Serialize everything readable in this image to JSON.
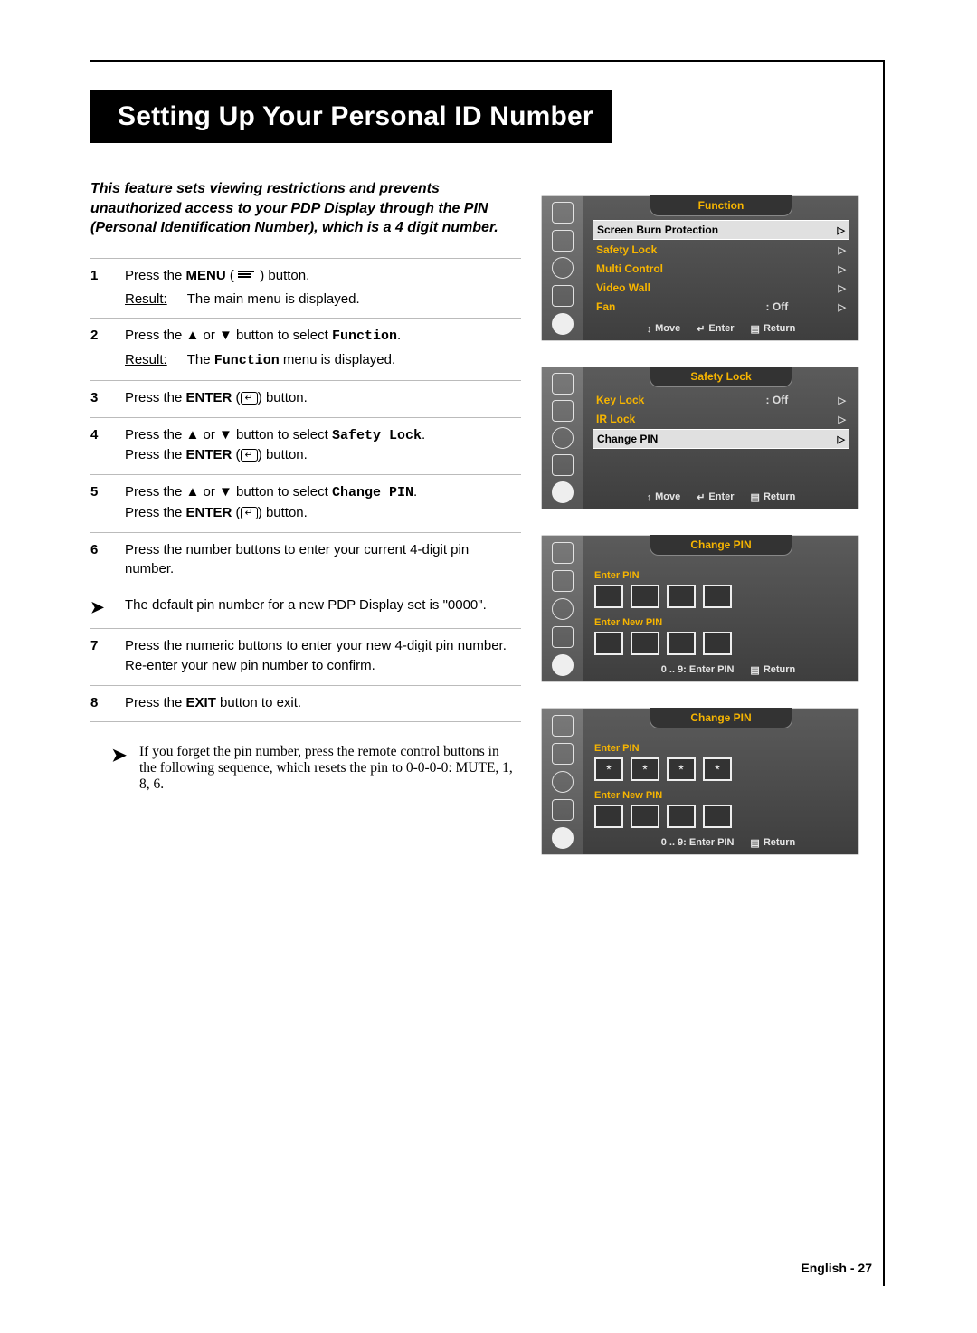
{
  "title": "Setting Up Your Personal ID Number",
  "intro": "This feature sets viewing restrictions and prevents unauthorized access to your PDP Display through the PIN (Personal Identification Number), which is a 4 digit number.",
  "step1": {
    "num": "1",
    "text_a": "Press the ",
    "menu": "MENU",
    "text_b": " button.",
    "result": "Result:",
    "result_text": "The main menu is displayed."
  },
  "step2": {
    "num": "2",
    "text_a": "Press the ▲ or ▼ button to select ",
    "mono": "Function",
    "text_b": ".",
    "result": "Result:",
    "result_text_a": "The ",
    "result_mono": "Function",
    "result_text_b": " menu is displayed."
  },
  "step3": {
    "num": "3",
    "text_a": "Press the ",
    "enter": "ENTER",
    "text_b": " button."
  },
  "step4": {
    "num": "4",
    "line1_a": "Press the ▲ or ▼ button to select ",
    "mono": "Safety Lock",
    "line1_b": ".",
    "line2_a": "Press the ",
    "enter": "ENTER",
    "line2_b": " button."
  },
  "step5": {
    "num": "5",
    "line1_a": "Press the ▲ or ▼ button to select ",
    "mono": "Change PIN",
    "line1_b": ".",
    "line2_a": "Press the ",
    "enter": "ENTER",
    "line2_b": " button."
  },
  "step6": {
    "num": "6",
    "text": "Press the number buttons to enter your current 4-digit pin number."
  },
  "step6_note": {
    "text_a": "The default pin number for a new PDP Display set is \"",
    "b": "0000",
    "text_b": "\"."
  },
  "step7": {
    "num": "7",
    "line1": "Press the numeric buttons to enter your new 4-digit pin number.",
    "line2": "Re-enter your new pin number to confirm."
  },
  "step8": {
    "num": "8",
    "text_a": "Press the ",
    "b": "EXIT",
    "text_b": " button to exit."
  },
  "tail": "If you forget the pin number, press the remote control buttons in the following sequence, which resets the pin to 0-0-0-0: MUTE, 1, 8, 6.",
  "osd": {
    "foot": {
      "move": "Move",
      "enter": "Enter",
      "return": "Return",
      "numeric": "0 .. 9: Enter PIN"
    },
    "p1": {
      "title": "Function",
      "items": [
        {
          "label": "Screen Burn Protection",
          "val": "",
          "selected": true
        },
        {
          "label": "Safety Lock",
          "val": ""
        },
        {
          "label": "Multi Control",
          "val": ""
        },
        {
          "label": "Video Wall",
          "val": ""
        },
        {
          "label": "Fan",
          "val": ": Off"
        }
      ]
    },
    "p2": {
      "title": "Safety Lock",
      "items": [
        {
          "label": "Key Lock",
          "val": ": Off"
        },
        {
          "label": "IR Lock",
          "val": ""
        },
        {
          "label": "Change PIN",
          "val": "",
          "selected": true
        }
      ]
    },
    "p3": {
      "title": "Change PIN",
      "enter_pin": "Enter PIN",
      "enter_new_pin": "Enter New PIN",
      "cells1": [
        "",
        "",
        "",
        ""
      ],
      "cells2": [
        "",
        "",
        "",
        ""
      ]
    },
    "p4": {
      "title": "Change PIN",
      "enter_pin": "Enter PIN",
      "enter_new_pin": "Enter New PIN",
      "cells1": [
        "*",
        "*",
        "*",
        "*"
      ],
      "cells2": [
        "",
        "",
        "",
        ""
      ]
    }
  },
  "page_num": "English - 27"
}
